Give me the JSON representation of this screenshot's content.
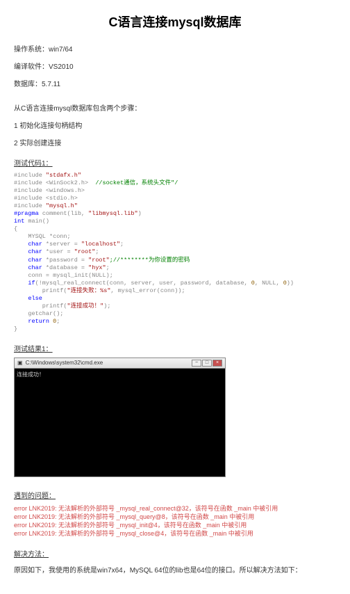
{
  "title": "C语言连接mysql数据库",
  "meta": {
    "os_label": "操作系统：",
    "os_value": "win7/64",
    "compiler_label": "编译软件：",
    "compiler_value": "VS2010",
    "db_label": "数据库：",
    "db_value": "5.7.11"
  },
  "intro": {
    "line1": "从C语言连接mysql数据库包含两个步骤：",
    "step1": "1 初始化连接句柄结构",
    "step2": "2 实际创建连接"
  },
  "code1_title": "测试代码1：",
  "code1": {
    "include1_pre": "#include",
    "include1_str": "\"stdafx.h\"",
    "include2_pre": "#include <WinSock2.h>",
    "include2_comment": "//socket通信，系统头文件\"/",
    "include3": "#include <windows.h>",
    "include4": "#include <stdio.h>",
    "include5_pre": "#include",
    "include5_str": "\"mysql.h\"",
    "pragma_pre": "#pragma",
    "pragma_rest": " comment(lib,",
    "pragma_str": "\"libmysql.lib\"",
    "pragma_end": ")",
    "int": "int",
    "main": " main()",
    "brace_open": "{",
    "declare": "    MYSQL *conn;",
    "char": "char",
    "server_decl": " *server = ",
    "server_str": "\"localhost\"",
    "semi": ";",
    "user_decl": " *user = ",
    "user_str": "\"root\"",
    "password_decl": " *password = ",
    "password_str": "\"root\"",
    "password_comment": ";//********为你设置的密码",
    "database_decl": " *database = ",
    "database_str": "\"hyx\"",
    "conn_init": "    conn = mysql_init(NULL);",
    "if": "if",
    "if_cond": "(!mysql_real_connect(conn, server, user, password, database, ",
    "zero1": "0",
    "null": ", NULL, ",
    "zero2": "0",
    "if_end": "))",
    "printf_fail": "        printf(",
    "fail_str": "\"连接失败：%s\"",
    "fail_rest": ", mysql_error(conn));",
    "else": "else",
    "printf_ok": "        printf(",
    "ok_str": "\"连接成功！\"",
    "ok_end": ");",
    "getchar": "    getchar();",
    "return": "return",
    "return_val": " 0",
    "brace_close": "}"
  },
  "result1_title": "测试结果1：",
  "terminal": {
    "title": "C:\\Windows\\system32\\cmd.exe",
    "output": "连接成功！"
  },
  "problem_title": "遇到的问题：",
  "errors": {
    "e1": "error LNK2019: 无法解析的外部符号 _mysql_real_connect@32，该符号在函数 _main 中被引用",
    "e2": "error LNK2019: 无法解析的外部符号 _mysql_query@8，该符号在函数 _main 中被引用",
    "e3": "error LNK2019: 无法解析的外部符号 _mysql_init@4，该符号在函数 _main 中被引用",
    "e4": "error LNK2019: 无法解析的外部符号 _mysql_close@4，该符号在函数 _main 中被引用"
  },
  "solution_title": "解决方法：",
  "solution_text": "原因如下，我使用的系统是win7x64，MySQL 64位的lib也是64位的接口。所以解决方法如下："
}
